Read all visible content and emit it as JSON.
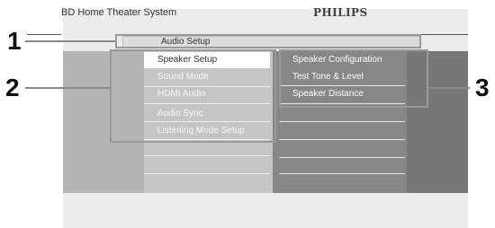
{
  "header": {
    "title": "BD Home Theater System",
    "brand": "PHILIPS"
  },
  "breadcrumb": {
    "label": "Audio Setup"
  },
  "menu": {
    "items": [
      {
        "label": "Speaker Setup",
        "selected": true
      },
      {
        "label": "Sound Mode",
        "selected": false
      },
      {
        "label": "HDMI Audio",
        "selected": false
      },
      {
        "label": "Audio Sync",
        "selected": false
      },
      {
        "label": "Listening Mode Setup",
        "selected": false
      }
    ]
  },
  "submenu": {
    "items": [
      {
        "label": "Speaker Configuration"
      },
      {
        "label": "Test Tone & Level"
      },
      {
        "label": "Speaker Distance"
      }
    ]
  },
  "callouts": {
    "one": "1",
    "two": "2",
    "three": "3"
  },
  "colors": {
    "screen_background": "#ececec",
    "menu_column": "#c5c5c5",
    "submenu_column": "#878787",
    "selected_item": "#ffffff",
    "callout_frame": "#999999"
  }
}
